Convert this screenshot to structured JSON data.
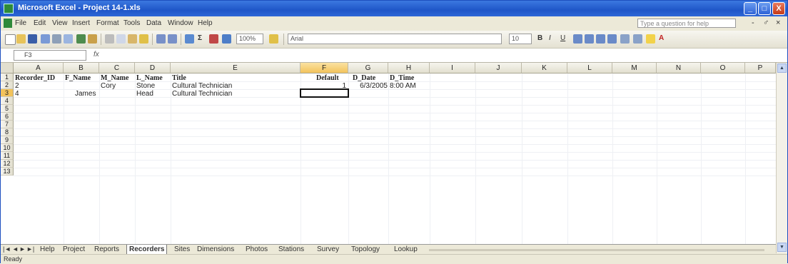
{
  "window": {
    "title": "Microsoft Excel - Project 14-1.xls",
    "controls": [
      "_",
      "□",
      "X"
    ]
  },
  "menu": {
    "items": [
      "File",
      "Edit",
      "View",
      "Insert",
      "Format",
      "Tools",
      "Data",
      "Window",
      "Help"
    ],
    "help_placeholder": "Type a question for help",
    "doc_controls": [
      "-",
      "♂",
      "×"
    ]
  },
  "toolbar": {
    "zoom": "100%",
    "font": "Arial",
    "font_size": "10",
    "bold": "B",
    "italic": "I",
    "underline": "U",
    "autosum": "Σ",
    "fill_label": "A"
  },
  "formula_bar": {
    "name_box": "F3",
    "fx": "fx",
    "content": ""
  },
  "sheet": {
    "columns": [
      "A",
      "B",
      "C",
      "D",
      "E",
      "F",
      "G",
      "H",
      "I",
      "J",
      "K",
      "L",
      "M",
      "N",
      "O",
      "P"
    ],
    "rows": [
      "1",
      "2",
      "3",
      "4",
      "5",
      "6",
      "7",
      "8",
      "9",
      "10",
      "11",
      "12",
      "13"
    ],
    "selected_column": "F",
    "selected_row": "3",
    "header_row": [
      "Recorder_ID",
      "F_Name",
      "M_Name",
      "L_Name",
      "Title",
      "Default",
      "D_Date",
      "D_Time"
    ],
    "row2": {
      "A": "2",
      "C": "Cory",
      "D": "Stone",
      "E": "Cultural Technician",
      "F": "1",
      "G": "6/3/2005",
      "H": "8:00 AM"
    },
    "row3": {
      "A": "4",
      "B": "James",
      "D": "Head",
      "E": "Cultural Technician"
    }
  },
  "tabs": {
    "nav": [
      "|◄",
      "◄",
      "►",
      "►|"
    ],
    "items": [
      "Help",
      "Project",
      "Reports",
      "Recorders",
      "Sites",
      "Dimensions",
      "Photos",
      "Stations",
      "Survey",
      "Topology",
      "Lookup"
    ],
    "active": "Recorders"
  },
  "status": {
    "text": "Ready"
  },
  "colors": {
    "titlebar": "#1f56c8",
    "selection": "#f2c35c",
    "chrome": "#ece9d8"
  }
}
